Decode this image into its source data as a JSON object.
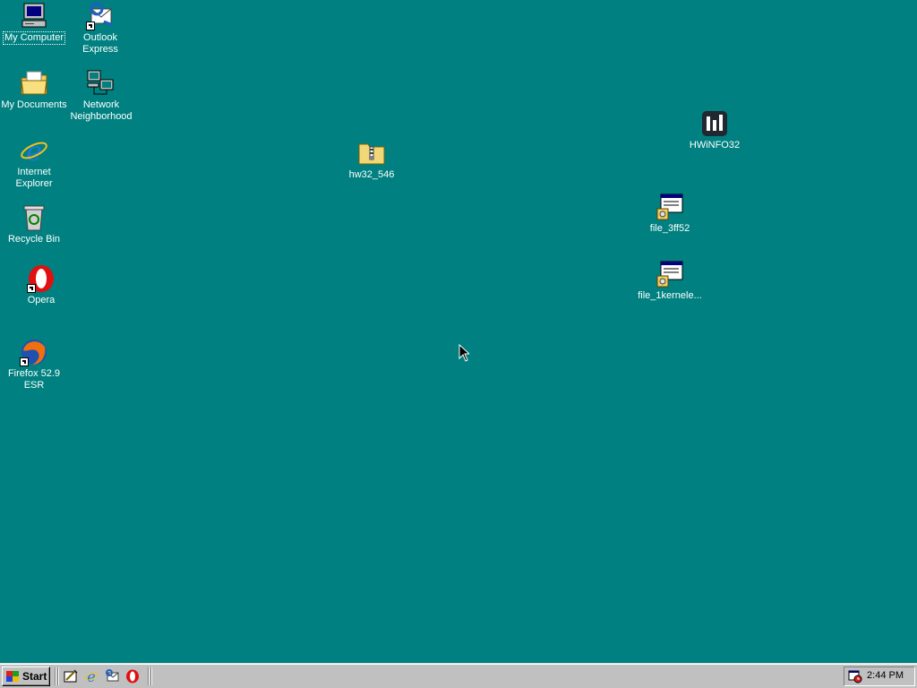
{
  "desktop": {
    "icons": [
      {
        "label": "My Computer",
        "icon": "my-computer-icon"
      },
      {
        "label": "Outlook Express",
        "icon": "outlook-express-icon"
      },
      {
        "label": "My Documents",
        "icon": "my-documents-icon"
      },
      {
        "label": "Network Neighborhood",
        "icon": "network-neighborhood-icon"
      },
      {
        "label": "Internet Explorer",
        "icon": "internet-explorer-icon"
      },
      {
        "label": "Recycle Bin",
        "icon": "recycle-bin-icon"
      },
      {
        "label": "Opera",
        "icon": "opera-icon"
      },
      {
        "label": "Firefox 52.9 ESR",
        "icon": "firefox-icon"
      },
      {
        "label": "hw32_546",
        "icon": "zip-folder-icon"
      },
      {
        "label": "HWiNFO32",
        "icon": "hwinfo-icon"
      },
      {
        "label": "file_3ff52",
        "icon": "setup-program-icon"
      },
      {
        "label": "file_1kernele...",
        "icon": "setup-program-icon"
      }
    ]
  },
  "taskbar": {
    "start_label": "Start",
    "quick_launch": [
      {
        "icon": "show-desktop-icon"
      },
      {
        "icon": "internet-explorer-icon"
      },
      {
        "icon": "outlook-express-icon"
      },
      {
        "icon": "opera-icon"
      }
    ],
    "clock": "2:44 PM",
    "tray_icon": "task-scheduler-icon"
  },
  "colors": {
    "desktop_background": "#008080",
    "taskbar": "#c0c0c0",
    "label_text": "#ffffff"
  }
}
